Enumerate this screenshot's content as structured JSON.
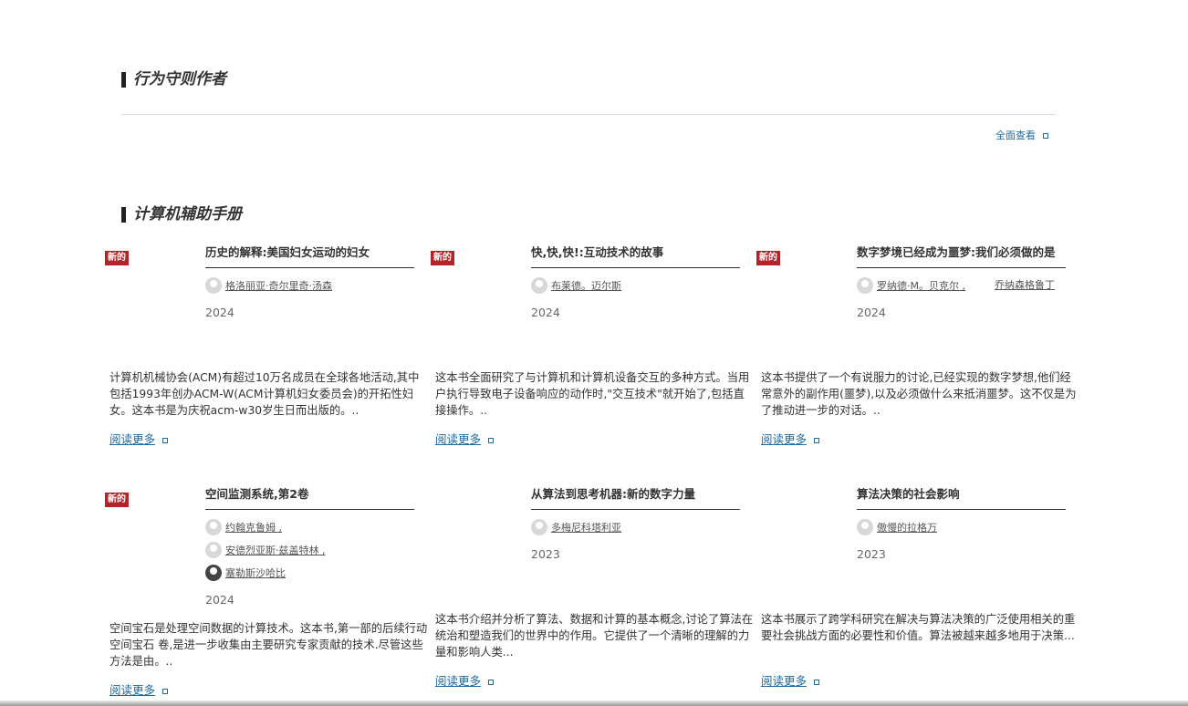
{
  "section1": {
    "title": "行为守则作者",
    "view_all": "全面查看"
  },
  "section2": {
    "title": "计算机辅助手册",
    "books": [
      {
        "badge": "新的",
        "title": "历史的解释:美国妇女运动的妇女",
        "authors": [
          "格洛丽亚·奇尔里奇·汤森"
        ],
        "year": "2024",
        "description": "计算机机械协会(ACM)有超过10万名成员在全球各地活动,其中包括1993年创办ACM-W(ACM计算机妇女委员会)的开拓性妇女。这本书是为庆祝acm-w30岁生日而出版的。..",
        "read_more": "阅读更多"
      },
      {
        "badge": "新的",
        "title": "快,快,快!:互动技术的故事",
        "authors": [
          "布莱德。迈尔斯"
        ],
        "year": "2024",
        "description": "这本书全面研究了与计算机和计算机设备交互的多种方式。当用户执行导致电子设备响应的动作时,\"交互技术\"就开始了,包括直接操作。..",
        "read_more": "阅读更多"
      },
      {
        "badge": "新的",
        "title": "数字梦境已经成为噩梦:我们必须做的是",
        "authors": [
          "罗纳德·M。贝克尔 ,",
          "乔纳森格鲁丁"
        ],
        "year": "2024",
        "description": "这本书提供了一个有说服力的讨论,已经实现的数字梦想,他们经常意外的副作用(噩梦),以及必须做什么来抵消噩梦。这不仅是为了推动进一步的对话。..",
        "read_more": "阅读更多"
      },
      {
        "badge": "新的",
        "title": "空间监测系统,第2卷",
        "authors": [
          "约翰克鲁姆 ,",
          "安德烈亚斯·兹盖特林 ,",
          "塞勒斯沙哈比"
        ],
        "year": "2024",
        "description": "空间宝石是处理空间数据的计算技术。这本书,第一部的后续行动 空间宝石 卷,是进一步收集由主要研究专家贡献的技术.尽管这些方法是由。..",
        "read_more": "阅读更多"
      },
      {
        "badge": "",
        "title": "从算法到思考机器:新的数字力量",
        "authors": [
          "多梅尼科塔利亚"
        ],
        "year": "2023",
        "description": "这本书介绍并分析了算法、数据和计算的基本概念,讨论了算法在统治和塑造我们的世界中的作用。它提供了一个清晰的理解的力量和影响人类...",
        "read_more": "阅读更多"
      },
      {
        "badge": "",
        "title": "算法决策的社会影响",
        "authors": [
          "傲慢的拉格万"
        ],
        "year": "2023",
        "description": "这本书展示了跨学科研究在解决与算法决策的广泛使用相关的重要社会挑战方面的必要性和价值。算法被越来越多地用于决策...",
        "read_more": "阅读更多"
      }
    ]
  }
}
